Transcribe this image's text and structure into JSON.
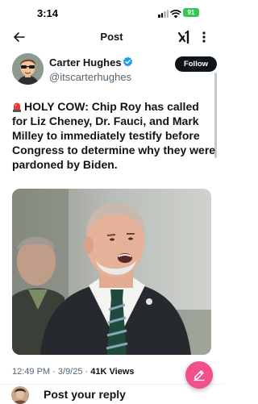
{
  "status_bar": {
    "time": "3:14",
    "battery": "91"
  },
  "nav": {
    "title": "Post"
  },
  "post": {
    "author_name": "Carter Hughes",
    "author_handle": "@itscarterhughes",
    "follow_label": "Follow",
    "text": "HOLY COW: Chip Roy has called for Liz Cheney, Dr. Fauci, and Mark Milley to immediately testify before Congress to determine why they were pardoned by Biden.",
    "time": "12:49 PM",
    "separator": "·",
    "date": "3/9/25",
    "views_count": "41K",
    "views_label": "Views"
  },
  "reply": {
    "placeholder": "Post your reply"
  },
  "icons": {
    "back": "back-arrow-icon",
    "grok": "grok-icon",
    "more": "more-icon",
    "verified": "verified-badge-icon",
    "siren": "siren-emoji-icon",
    "compose": "compose-icon"
  },
  "colors": {
    "accent_fab": "#f0508b",
    "verified": "#1d9bf0",
    "text_primary": "#0f1419",
    "text_secondary": "#536471",
    "battery": "#33c759"
  }
}
